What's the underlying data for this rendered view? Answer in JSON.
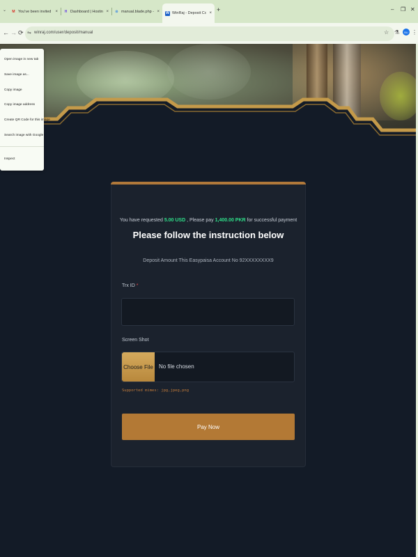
{
  "browser": {
    "tabs": [
      {
        "title": "You've been invited to collab",
        "favicon": "gmail-icon",
        "color": "#d93025",
        "glyph": "M"
      },
      {
        "title": "Dashboard | Hostinger",
        "favicon": "hostinger-icon",
        "color": "#673de6",
        "glyph": "H"
      },
      {
        "title": "manual.blade.php - Files - File",
        "favicon": "cpanel-icon",
        "color": "#1a73e8",
        "glyph": "⊙"
      },
      {
        "title": "WinRaj - Deposit Confirm",
        "favicon": "winraj-icon",
        "color": "#1a5fc8",
        "glyph": "W"
      }
    ],
    "close_glyph": "×",
    "new_tab_glyph": "+",
    "tab_menu_glyph": "⌄",
    "window_controls": [
      "–",
      "❐",
      "✕"
    ],
    "nav": {
      "back": "←",
      "forward": "→",
      "reload": "⟳"
    },
    "url": "winraj.com/user/deposit/manual",
    "site_info_glyph": "⇋",
    "star_glyph": "☆",
    "flask_glyph": "⚗",
    "avatar_text": "BU",
    "menu_glyph": "⋮"
  },
  "context_menu": {
    "items": [
      "Open image in new tab",
      "Save image as...",
      "Copy image",
      "Copy image address",
      "Create QR Code for this image",
      "Search image with Google",
      "Inspect"
    ]
  },
  "deposit": {
    "request_prefix": "You have requested",
    "usd_amount": "5.00 USD",
    "request_middle": ", Please pay",
    "pkr_amount": "1,400.00 PKR",
    "request_suffix": "for successful payment",
    "heading": "Please follow the instruction below",
    "instruction": "Deposit Amount This Easypaisa Account No 92XXXXXXXX9",
    "trx_label": "Trx ID",
    "required_mark": "*",
    "screenshot_label": "Screen Shot",
    "choose_file": "Choose File",
    "no_file": "No file chosen",
    "supported": "Supported mimes: jpg,jpeg,png",
    "submit": "Pay Now"
  },
  "colors": {
    "accent": "#b37935",
    "success": "#2fe08a",
    "background": "#131b27",
    "card": "#1b222d"
  }
}
